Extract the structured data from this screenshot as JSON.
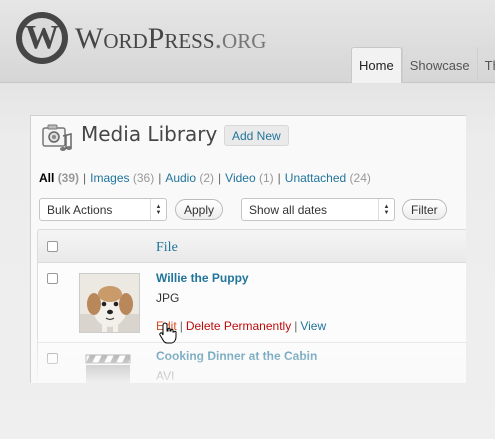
{
  "header": {
    "logo_letter": "W",
    "wordmark": "WordPress",
    "wordmark_suffix": ".org",
    "tabs": [
      {
        "label": "Home",
        "active": true
      },
      {
        "label": "Showcase",
        "active": false
      },
      {
        "label": "Th",
        "active": false
      }
    ]
  },
  "page": {
    "title": "Media Library",
    "add_new_label": "Add New"
  },
  "filters": [
    {
      "label": "All",
      "count": "(39)",
      "current": true
    },
    {
      "label": "Images",
      "count": "(36)",
      "current": false
    },
    {
      "label": "Audio",
      "count": "(2)",
      "current": false
    },
    {
      "label": "Video",
      "count": "(1)",
      "current": false
    },
    {
      "label": "Unattached",
      "count": "(24)",
      "current": false
    }
  ],
  "filter_separator": "|",
  "toolbar": {
    "bulk_actions_value": "Bulk Actions",
    "apply_label": "Apply",
    "date_filter_value": "Show all dates",
    "filter_label": "Filter"
  },
  "table": {
    "column_file": "File",
    "rows": [
      {
        "title": "Willie the Puppy",
        "type": "JPG",
        "actions": {
          "edit": "Edit",
          "delete": "Delete Permanently",
          "view": "View"
        }
      },
      {
        "title": "Cooking Dinner at the Cabin",
        "type": "AVI"
      }
    ]
  },
  "colors": {
    "link": "#21759b",
    "edit": "#d54e21",
    "delete": "#bc0b0b",
    "text": "#464646"
  }
}
